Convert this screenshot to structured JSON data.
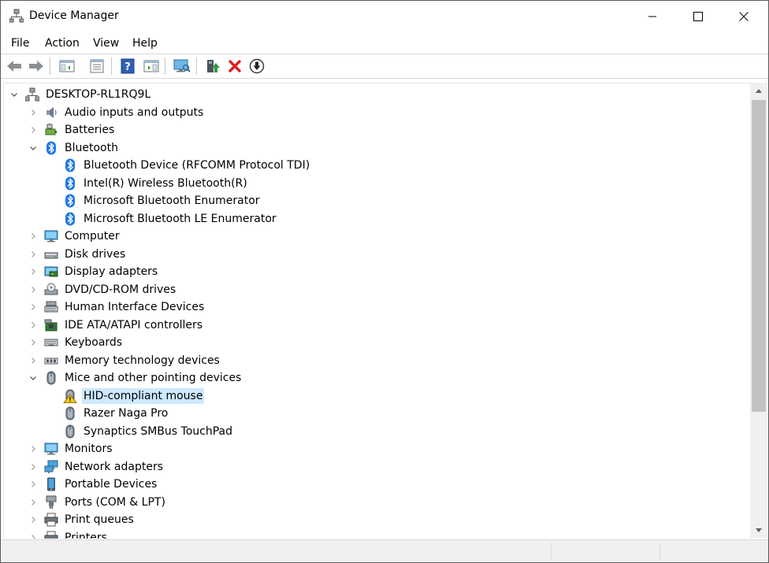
{
  "window": {
    "title": "Device Manager"
  },
  "menu": [
    "File",
    "Action",
    "View",
    "Help"
  ],
  "toolbar": [
    "back-icon",
    "forward-icon",
    "show-hide-console-tree-icon",
    "properties-icon",
    "help-icon",
    "action-pane-icon",
    "scan-hardware-icon",
    "update-driver-icon",
    "uninstall-device-icon",
    "disable-device-icon"
  ],
  "tree": {
    "root": "DESKTOP-RL1RQ9L",
    "items": [
      {
        "label": "Audio inputs and outputs",
        "level": 1,
        "expanded": false,
        "icon": "speaker-icon"
      },
      {
        "label": "Batteries",
        "level": 1,
        "expanded": false,
        "icon": "battery-icon"
      },
      {
        "label": "Bluetooth",
        "level": 1,
        "expanded": true,
        "icon": "bluetooth-icon"
      },
      {
        "label": "Bluetooth Device (RFCOMM Protocol TDI)",
        "level": 2,
        "icon": "bluetooth-icon"
      },
      {
        "label": "Intel(R) Wireless Bluetooth(R)",
        "level": 2,
        "icon": "bluetooth-icon"
      },
      {
        "label": "Microsoft Bluetooth Enumerator",
        "level": 2,
        "icon": "bluetooth-icon"
      },
      {
        "label": "Microsoft Bluetooth LE Enumerator",
        "level": 2,
        "icon": "bluetooth-icon"
      },
      {
        "label": "Computer",
        "level": 1,
        "expanded": false,
        "icon": "monitor-icon"
      },
      {
        "label": "Disk drives",
        "level": 1,
        "expanded": false,
        "icon": "disk-drive-icon"
      },
      {
        "label": "Display adapters",
        "level": 1,
        "expanded": false,
        "icon": "display-adapter-icon"
      },
      {
        "label": "DVD/CD-ROM drives",
        "level": 1,
        "expanded": false,
        "icon": "dvd-drive-icon"
      },
      {
        "label": "Human Interface Devices",
        "level": 1,
        "expanded": false,
        "icon": "hid-icon"
      },
      {
        "label": "IDE ATA/ATAPI controllers",
        "level": 1,
        "expanded": false,
        "icon": "ide-controller-icon"
      },
      {
        "label": "Keyboards",
        "level": 1,
        "expanded": false,
        "icon": "keyboard-icon"
      },
      {
        "label": "Memory technology devices",
        "level": 1,
        "expanded": false,
        "icon": "memory-device-icon"
      },
      {
        "label": "Mice and other pointing devices",
        "level": 1,
        "expanded": true,
        "icon": "mouse-icon"
      },
      {
        "label": "HID-compliant mouse",
        "level": 2,
        "icon": "mouse-warning-icon",
        "selected": true
      },
      {
        "label": "Razer Naga Pro",
        "level": 2,
        "icon": "mouse-icon"
      },
      {
        "label": "Synaptics SMBus TouchPad",
        "level": 2,
        "icon": "mouse-icon"
      },
      {
        "label": "Monitors",
        "level": 1,
        "expanded": false,
        "icon": "monitor-icon"
      },
      {
        "label": "Network adapters",
        "level": 1,
        "expanded": false,
        "icon": "network-adapter-icon"
      },
      {
        "label": "Portable Devices",
        "level": 1,
        "expanded": false,
        "icon": "portable-device-icon"
      },
      {
        "label": "Ports (COM & LPT)",
        "level": 1,
        "expanded": false,
        "icon": "port-icon"
      },
      {
        "label": "Print queues",
        "level": 1,
        "expanded": false,
        "icon": "printer-icon"
      },
      {
        "label": "Printers",
        "level": 1,
        "expanded": false,
        "icon": "printer-icon"
      }
    ]
  },
  "colors": {
    "selection": "#cce8ff",
    "bluetooth": "#1e7ae0",
    "warning": "#f5c518"
  }
}
